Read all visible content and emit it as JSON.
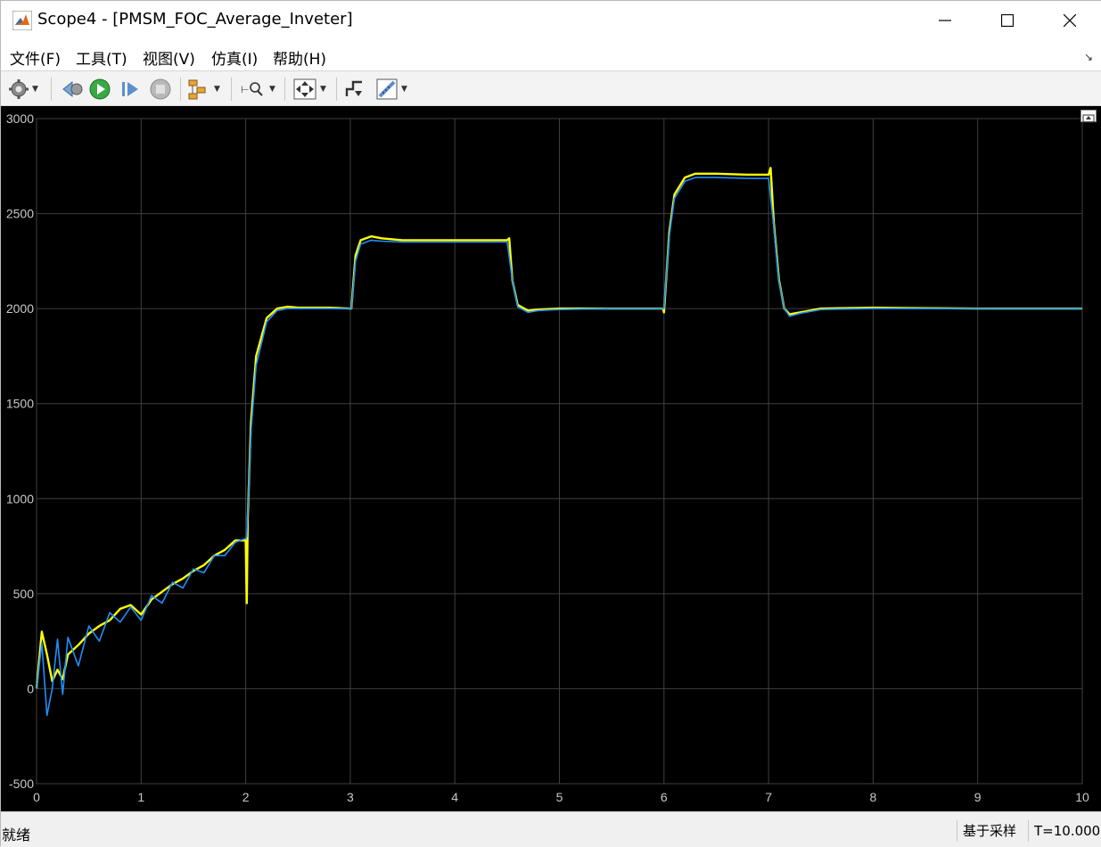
{
  "window": {
    "title": "Scope4 - [PMSM_FOC_Average_Inveter]",
    "icon": "matlab-icon"
  },
  "menu": [
    {
      "label": "文件(F)"
    },
    {
      "label": "工具(T)"
    },
    {
      "label": "视图(V)"
    },
    {
      "label": "仿真(I)"
    },
    {
      "label": "帮助(H)"
    }
  ],
  "toolbar": {
    "icons": [
      "gear-icon",
      "step-back-icon",
      "run-icon",
      "step-forward-icon",
      "stop-icon",
      "signal-hierarchy-icon",
      "zoom-icon",
      "autoscale-icon",
      "triggers-icon",
      "measure-icon"
    ]
  },
  "status": {
    "left": "就绪",
    "sampling": "基于采样",
    "time": "T=10.000"
  },
  "colors": {
    "plot_bg": "#000000",
    "grid": "#404040",
    "series_yellow": "#ffff00",
    "series_blue": "#1e90ff"
  },
  "chart_data": {
    "type": "line",
    "xlim": [
      0,
      10
    ],
    "ylim": [
      -500,
      3000
    ],
    "x_ticks": [
      0,
      1,
      2,
      3,
      4,
      5,
      6,
      7,
      8,
      9,
      10
    ],
    "y_ticks": [
      -500,
      0,
      500,
      1000,
      1500,
      2000,
      2500,
      3000
    ],
    "grid": true,
    "series": [
      {
        "color": "#ffff00",
        "x": [
          0,
          0.05,
          0.1,
          0.15,
          0.2,
          0.25,
          0.3,
          0.4,
          0.5,
          0.6,
          0.7,
          0.8,
          0.9,
          1.0,
          1.1,
          1.2,
          1.3,
          1.4,
          1.5,
          1.6,
          1.7,
          1.8,
          1.9,
          2.0,
          2.01,
          2.02,
          2.05,
          2.1,
          2.2,
          2.3,
          2.4,
          2.5,
          2.6,
          2.8,
          3.0,
          3.01,
          3.05,
          3.1,
          3.2,
          3.3,
          3.5,
          4.0,
          4.5,
          4.52,
          4.55,
          4.6,
          4.7,
          4.8,
          5.0,
          5.5,
          5.99,
          6.0,
          6.05,
          6.1,
          6.2,
          6.3,
          6.5,
          6.8,
          7.0,
          7.02,
          7.05,
          7.1,
          7.15,
          7.2,
          7.3,
          7.5,
          8.0,
          9.0,
          10.0
        ],
        "y": [
          0,
          300,
          180,
          40,
          100,
          50,
          180,
          230,
          290,
          330,
          360,
          420,
          440,
          390,
          470,
          510,
          550,
          580,
          620,
          650,
          700,
          730,
          780,
          780,
          450,
          900,
          1400,
          1750,
          1950,
          2000,
          2010,
          2005,
          2005,
          2005,
          2000,
          2000,
          2280,
          2360,
          2380,
          2370,
          2360,
          2360,
          2360,
          2370,
          2150,
          2020,
          1990,
          1995,
          2000,
          2000,
          2000,
          1980,
          2400,
          2600,
          2690,
          2710,
          2710,
          2705,
          2705,
          2740,
          2450,
          2150,
          2000,
          1970,
          1980,
          2000,
          2005,
          2000,
          2000
        ]
      },
      {
        "color": "#1e90ff",
        "x": [
          0,
          0.05,
          0.1,
          0.15,
          0.2,
          0.25,
          0.3,
          0.4,
          0.5,
          0.6,
          0.7,
          0.8,
          0.9,
          1.0,
          1.1,
          1.2,
          1.3,
          1.4,
          1.5,
          1.6,
          1.7,
          1.8,
          1.9,
          2.0,
          2.01,
          2.05,
          2.1,
          2.2,
          2.3,
          2.4,
          2.5,
          2.6,
          2.8,
          3.0,
          3.01,
          3.05,
          3.1,
          3.2,
          3.3,
          3.5,
          4.0,
          4.5,
          4.55,
          4.6,
          4.7,
          4.8,
          5.0,
          5.5,
          6.0,
          6.05,
          6.1,
          6.2,
          6.3,
          6.5,
          6.8,
          7.0,
          7.05,
          7.1,
          7.15,
          7.2,
          7.3,
          7.5,
          8.0,
          9.0,
          10.0
        ],
        "y": [
          0,
          240,
          -140,
          0,
          260,
          -30,
          270,
          120,
          330,
          250,
          400,
          350,
          430,
          360,
          490,
          450,
          560,
          530,
          630,
          610,
          700,
          700,
          770,
          790,
          800,
          1350,
          1700,
          1930,
          1990,
          2000,
          2000,
          2000,
          2000,
          2000,
          2000,
          2250,
          2340,
          2360,
          2355,
          2350,
          2350,
          2350,
          2150,
          2010,
          1980,
          1990,
          1995,
          2000,
          2000,
          2380,
          2580,
          2670,
          2690,
          2690,
          2685,
          2685,
          2430,
          2140,
          2000,
          1960,
          1975,
          1995,
          2000,
          2000,
          2000
        ]
      }
    ]
  }
}
